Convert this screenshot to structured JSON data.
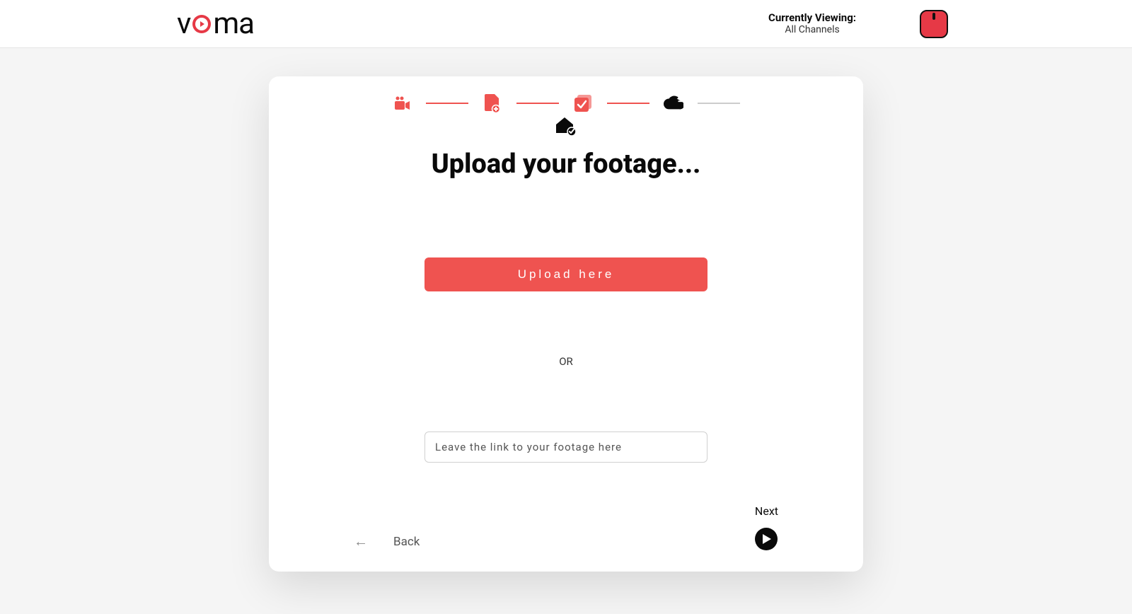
{
  "header": {
    "logo_text_before": "v",
    "logo_text_after": "ma",
    "viewing_label": "Currently Viewing:",
    "viewing_value": "All Channels"
  },
  "stepper": {
    "steps": [
      {
        "name": "video-camera-icon",
        "state": "done"
      },
      {
        "name": "file-plus-icon",
        "state": "done"
      },
      {
        "name": "check-box-icon",
        "state": "done"
      },
      {
        "name": "cloud-upload-icon",
        "state": "current"
      }
    ],
    "sub_icon": "home-check-icon"
  },
  "main": {
    "title": "Upload your footage...",
    "upload_button_label": "Upload here",
    "or_label": "OR",
    "link_placeholder": "Leave the link to your footage here",
    "link_value": ""
  },
  "footer": {
    "back_label": "Back",
    "next_label": "Next"
  },
  "colors": {
    "accent": "#ef5350",
    "dark": "#0a0a0a"
  }
}
